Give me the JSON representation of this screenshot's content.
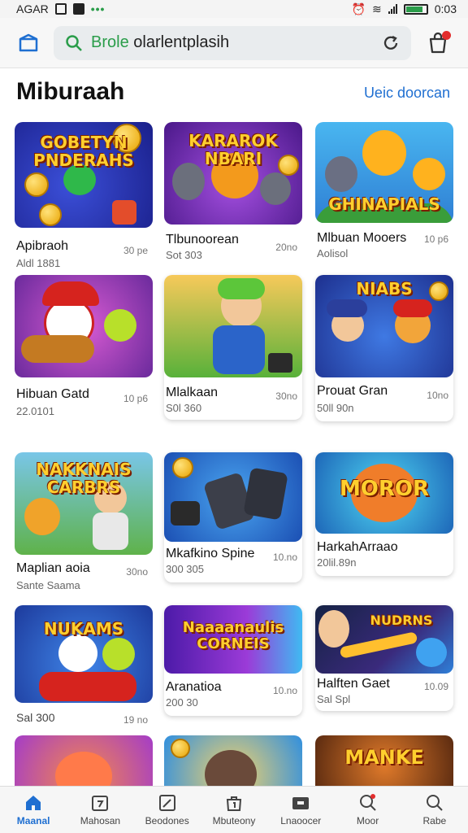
{
  "status_bar": {
    "carrier": "AGAR",
    "time": "0:03"
  },
  "search": {
    "brand": "Brole",
    "text": "olarlentplasih"
  },
  "section": {
    "title": "Miburaah",
    "link": "Ueic doorcan"
  },
  "cards": [
    {
      "art_title": "GOBETYN PNDERAHS",
      "name": "Apibraoh",
      "sub": "Aldl 1881",
      "count": "30 pe"
    },
    {
      "art_title": "KARAROK NBARI",
      "name": "Tlbunoorean",
      "sub": "Sot 303",
      "count": "20no"
    },
    {
      "art_title": "GHINAPIALS",
      "name": "Mlbuan Mooers",
      "sub": "Aolisol",
      "count": "10 p6"
    },
    {
      "art_title": "",
      "name": "Hibuan Gatd",
      "sub": "22.0101",
      "count": "10 p6"
    },
    {
      "art_title": "",
      "name": "Mlalkaan",
      "sub": "S0l 360",
      "count": "30no"
    },
    {
      "art_title": "NIABS",
      "name": "Prouat Gran",
      "sub": "50ll 90n",
      "count": "10no"
    },
    {
      "art_title": "NAKKNAIS CARBRS",
      "name": "Maplian aoia",
      "sub": "Sante Saama",
      "count": "30no"
    },
    {
      "art_title": "",
      "name": "Mkafkino Spine",
      "sub": "300 305",
      "count": "10.no"
    },
    {
      "art_title": "MOROR",
      "name": "HarkahArraao",
      "sub": "20lil.89n",
      "count": ""
    },
    {
      "art_title": "NUKAMS",
      "name": "",
      "sub": "",
      "count": "",
      "extra": "Sal 300",
      "extra_count": "19 no"
    },
    {
      "art_title": "Naaaanaulis CORNEIS",
      "name": "Aranatioa",
      "sub": "200 30",
      "count": "10.no"
    },
    {
      "art_title": "NUDRNS",
      "name": "Halften Gaet",
      "sub": "Sal Spl",
      "count": "10.09"
    },
    {
      "art_title": "",
      "name": "",
      "sub": "",
      "count": ""
    },
    {
      "art_title": "",
      "name": "",
      "sub": "",
      "count": ""
    },
    {
      "art_title": "MANKE",
      "name": "",
      "sub": "",
      "count": ""
    }
  ],
  "nav": [
    {
      "label": "Maanal",
      "icon": "home-icon",
      "active": true
    },
    {
      "label": "Mahosan",
      "icon": "calendar-icon"
    },
    {
      "label": "Beodones",
      "icon": "edit-icon"
    },
    {
      "label": "Mbuteony",
      "icon": "bag-icon"
    },
    {
      "label": "Lnaoocer",
      "icon": "folder-icon"
    },
    {
      "label": "Moor",
      "icon": "search-alert-icon"
    },
    {
      "label": "Rabe",
      "icon": "search-icon"
    }
  ],
  "colors": {
    "accent": "#1f6fd1",
    "status_green": "#2a9d4a",
    "badge_red": "#e22d2d"
  }
}
